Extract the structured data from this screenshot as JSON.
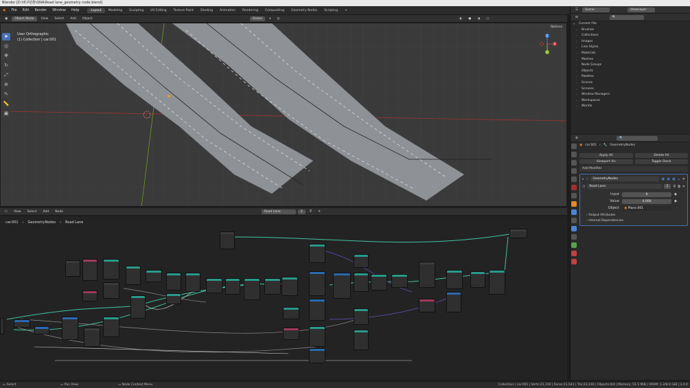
{
  "window_title": "Blender [D:\\바구단훈\\QNA\\Road lane_geometry node.blend]",
  "menus": [
    "File",
    "Edit",
    "Render",
    "Window",
    "Help"
  ],
  "workspaces": [
    "Layout",
    "Modeling",
    "Sculpting",
    "UV Editing",
    "Texture Paint",
    "Shading",
    "Animation",
    "Rendering",
    "Compositing",
    "Geometry Nodes",
    "Scripting",
    "+"
  ],
  "active_workspace": "Layout",
  "viewport_header": {
    "mode": "Object Mode",
    "menus": [
      "View",
      "Select",
      "Add",
      "Object"
    ],
    "orientation": "Global",
    "options": "Options"
  },
  "viewport_info": {
    "view": "User Orthographic",
    "collection": "(1) Collection | car.001"
  },
  "gizmo": {
    "x": "X",
    "y": "Y",
    "z": "Z"
  },
  "node_editor": {
    "menus": [
      "View",
      "Select",
      "Add",
      "Node"
    ],
    "tree_name": "Road Lane",
    "users": "2",
    "breadcrumb": [
      "car.001",
      "GeometryNodes",
      "Road Lane"
    ]
  },
  "outliner": {
    "display_mode": "Scene",
    "view_layer": "ViewLayer",
    "root": "Current File",
    "items": [
      "Brushes",
      "Collections",
      "Images",
      "Line Styles",
      "Materials",
      "Meshes",
      "Node Groups",
      "Objects",
      "Palettes",
      "Scenes",
      "Screens",
      "Window Managers",
      "Workspaces",
      "Worlds"
    ]
  },
  "properties": {
    "object": "car.001",
    "modifier_tab": "GeometryNodes",
    "apply_all": "Apply All",
    "delete_all": "Delete All",
    "viewport_vis": "Viewport Vis",
    "toggle_stack": "Toggle Stack",
    "add_modifier": "Add Modifier",
    "modifier_name": "GeometryNodes",
    "node_group": "Road Lane",
    "node_group_users": "2",
    "inputs": [
      {
        "label": "Input",
        "value": "6"
      },
      {
        "label": "Value",
        "value": "4.000"
      },
      {
        "label": "Object",
        "value": "Plane.001"
      }
    ],
    "output_attributes": "Output Attributes",
    "internal_dependencies": "Internal Dependencies"
  },
  "status_bar": {
    "select": "Select",
    "pan": "Pan View",
    "context": "Node Context Menu",
    "stats": "Collection | car.001 | Verts:23,150 | Faces:11,541 | Tris:23,140 | Objects:0/4 | Memory: 51.5 MiB | VRAM: 1.2/8.0 GiB | 3.0.0"
  },
  "colors": {
    "selected": "#4772b3",
    "road": "#8e9196",
    "node_link": "#3fc4a3",
    "axis_x": "#c83a3a",
    "axis_y": "#8bb82a"
  }
}
